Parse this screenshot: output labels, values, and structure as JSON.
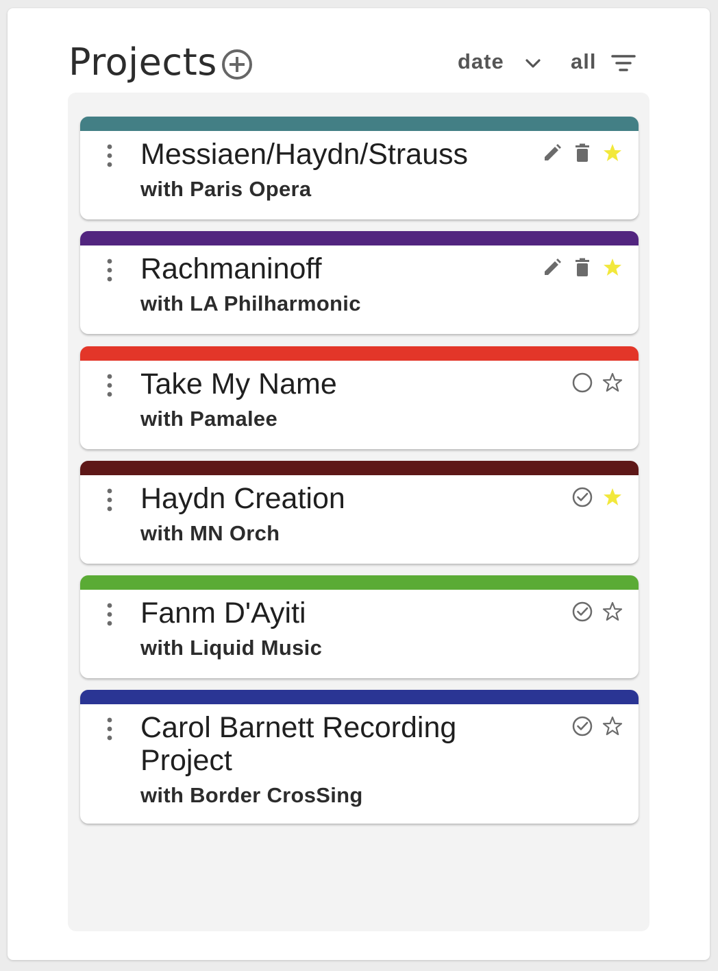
{
  "header": {
    "title": "Projects",
    "sort_label": "date",
    "filter_label": "all"
  },
  "projects": [
    {
      "title": "Messiaen/Haydn/Strauss",
      "subtitle": "with Paris Opera",
      "color": "#437f85",
      "actions": [
        "edit-icon",
        "delete-icon"
      ],
      "starred": true
    },
    {
      "title": "Rachmaninoff",
      "subtitle": "with LA Philharmonic",
      "color": "#52257f",
      "actions": [
        "edit-icon",
        "delete-icon"
      ],
      "starred": true
    },
    {
      "title": "Take My Name",
      "subtitle": "with Pamalee",
      "color": "#e33629",
      "actions": [
        "circle-icon"
      ],
      "starred": false
    },
    {
      "title": "Haydn Creation",
      "subtitle": "with MN Orch",
      "color": "#5e1818",
      "actions": [
        "check-circle-icon"
      ],
      "starred": true
    },
    {
      "title": "Fanm D'Ayiti",
      "subtitle": "with Liquid Music",
      "color": "#5aab35",
      "actions": [
        "check-circle-icon"
      ],
      "starred": false
    },
    {
      "title": "Carol Barnett Recording Project",
      "subtitle": "with Border CrosSing",
      "color": "#2a3594",
      "actions": [
        "check-circle-icon"
      ],
      "starred": false
    }
  ],
  "colors": {
    "star_filled": "#f2e83c",
    "icon_gray": "#6b6b6b"
  }
}
